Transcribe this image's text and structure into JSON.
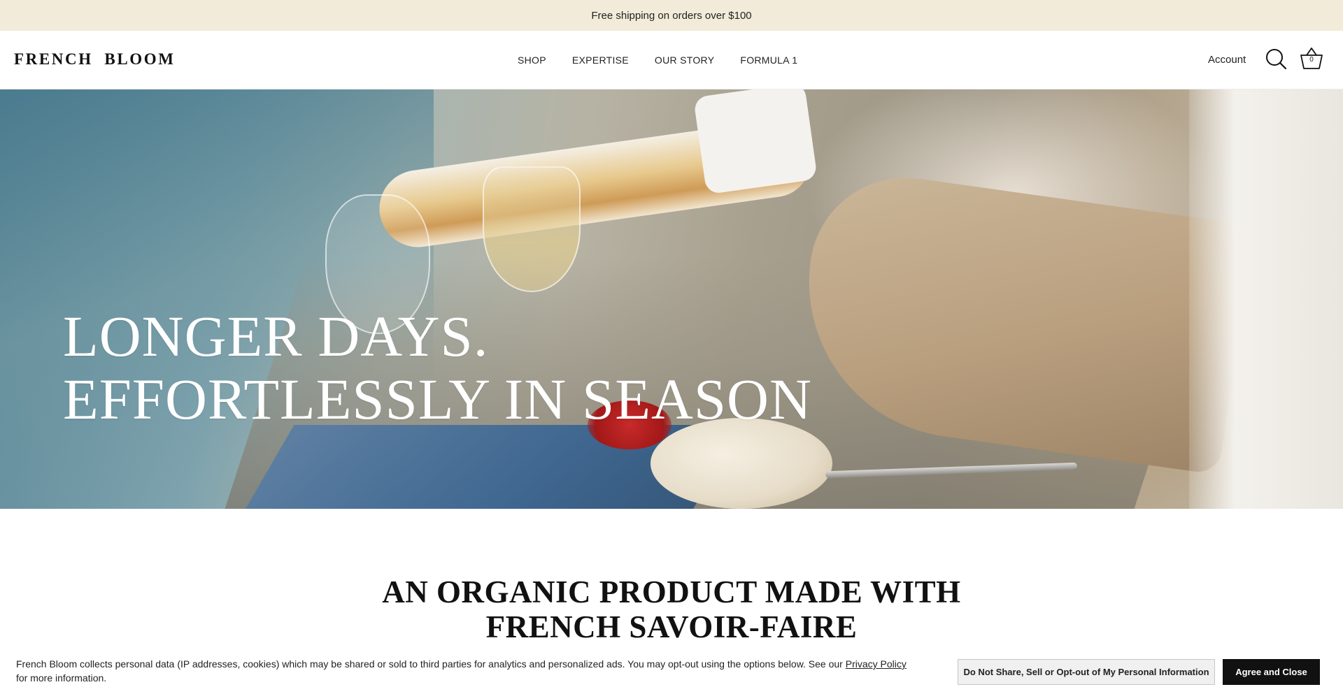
{
  "announcement": {
    "text": "Free shipping on orders over $100"
  },
  "header": {
    "logo": "FRENCH  BLOOM",
    "nav": [
      {
        "label": "SHOP"
      },
      {
        "label": "EXPERTISE"
      },
      {
        "label": "OUR STORY"
      },
      {
        "label": "FORMULA 1"
      }
    ],
    "account_label": "Account",
    "search_icon": "search-icon",
    "cart_icon": "basket-icon",
    "cart_count": "0"
  },
  "hero": {
    "title_line1": "LONGER DAYS.",
    "title_line2": "EFFORTLESSLY IN SEASON"
  },
  "section": {
    "title_line1": "AN ORGANIC PRODUCT MADE WITH",
    "title_line2": "FRENCH SAVOIR-FAIRE"
  },
  "cookie_banner": {
    "text_before_link": "French Bloom collects personal data (IP addresses, cookies) which may be shared or sold to third parties for analytics and personalized ads. You may opt-out using the options below. See our ",
    "link_label": "Privacy Policy",
    "text_after_link": " for more information.",
    "optout_label": "Do Not Share, Sell or Opt-out of My Personal Information",
    "agree_label": "Agree and Close"
  },
  "colors": {
    "announcement_bg": "#f2ebd9",
    "agree_button_bg": "#111111"
  }
}
